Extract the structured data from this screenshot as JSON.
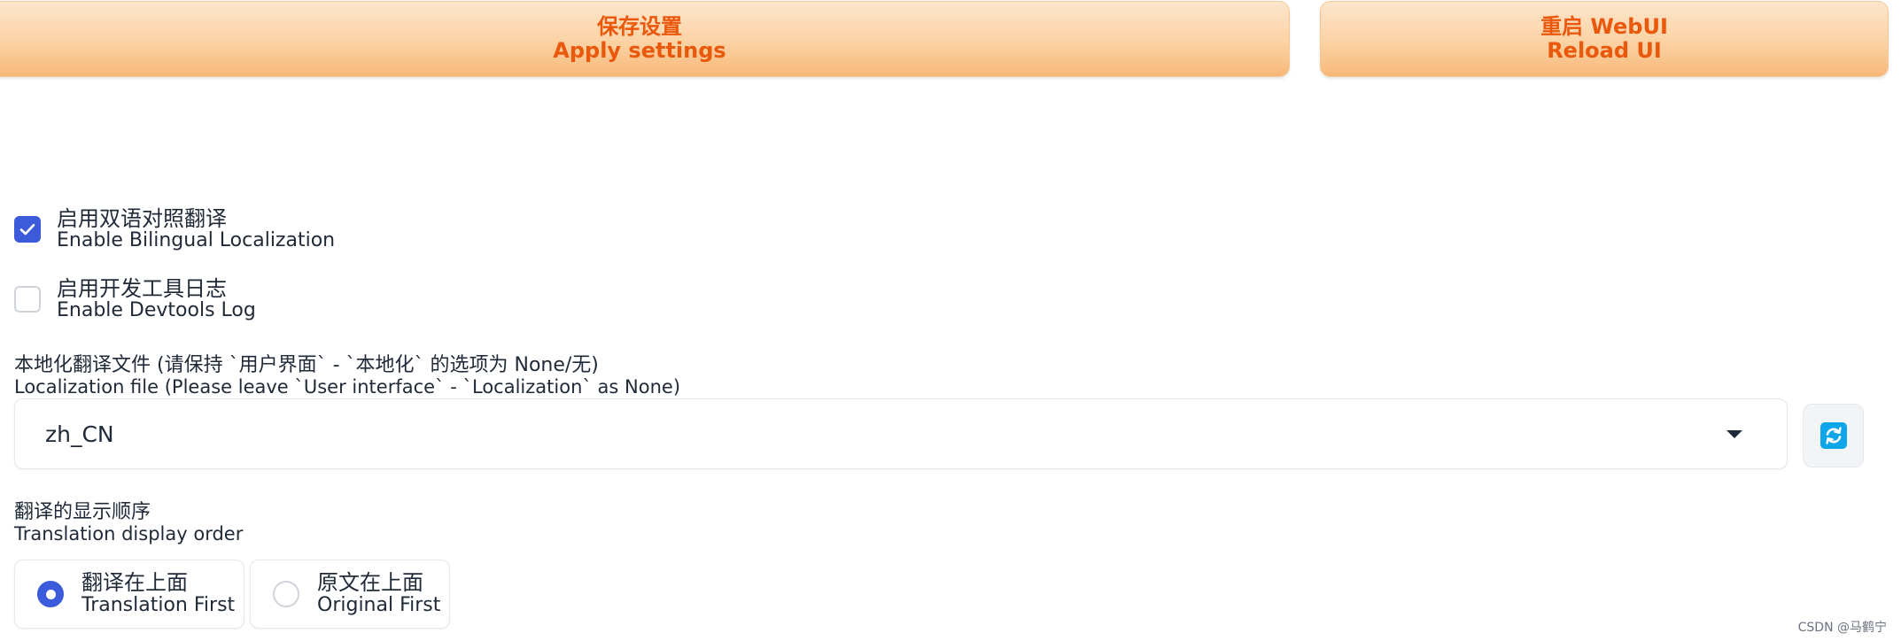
{
  "buttons": {
    "apply": {
      "zh": "保存设置",
      "en": "Apply settings"
    },
    "reload": {
      "zh": "重启 WebUI",
      "en": "Reload UI"
    }
  },
  "settings": {
    "bilingual": {
      "zh": "启用双语对照翻译",
      "en": "Enable Bilingual Localization",
      "checked": true
    },
    "devtools": {
      "zh": "启用开发工具日志",
      "en": "Enable Devtools Log",
      "checked": false
    }
  },
  "localization_file": {
    "label_zh": "本地化翻译文件 (请保持 `用户界面` - `本地化` 的选项为 None/无)",
    "label_en": "Localization file (Please leave `User interface` - `Localization` as None)",
    "value": "zh_CN"
  },
  "display_order": {
    "label_zh": "翻译的显示顺序",
    "label_en": "Translation display order",
    "options": [
      {
        "zh": "翻译在上面",
        "en": "Translation First",
        "selected": true
      },
      {
        "zh": "原文在上面",
        "en": "Original First",
        "selected": false
      }
    ]
  },
  "icons": {
    "checkmark": "checkmark-icon",
    "refresh": "refresh-icon",
    "caret": "chevron-down-icon"
  },
  "colors": {
    "accent": "#3b5bdb",
    "button_text": "#ea580c",
    "refresh_icon": "#0ea5e9"
  },
  "watermark": "CSDN @马鹤宁"
}
